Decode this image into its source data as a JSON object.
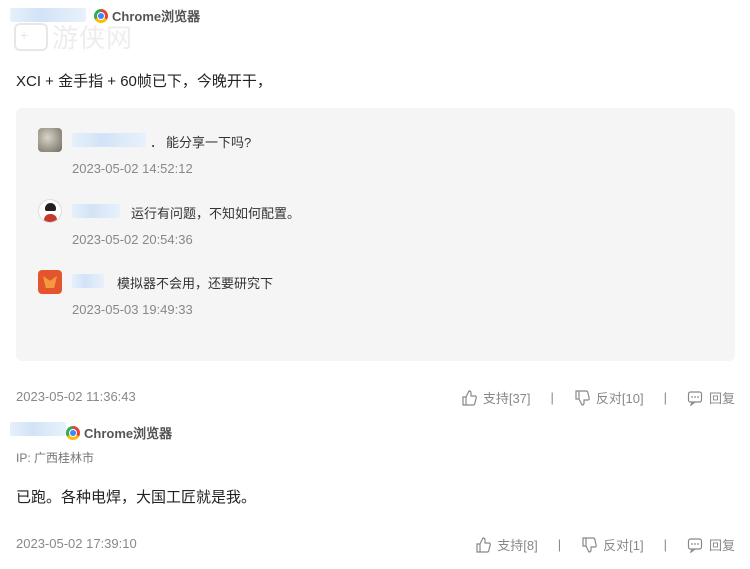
{
  "watermark": {
    "text": "游侠网"
  },
  "comment1": {
    "browser": "Chrome浏览器",
    "text": "XCI + 金手指 + 60帧已下，今晚开干，",
    "time": "2023-05-02 11:36:43",
    "support": "支持[37]",
    "oppose": "反对[10]",
    "reply": "回复",
    "replies": [
      {
        "name_suffix": "．",
        "text": "能分享一下吗?",
        "time": "2023-05-02 14:52:12"
      },
      {
        "text": "运行有问题，不知如何配置。",
        "time": "2023-05-02 20:54:36"
      },
      {
        "text": "模拟器不会用，还要研究下",
        "time": "2023-05-03 19:49:33"
      }
    ]
  },
  "comment2": {
    "browser": "Chrome浏览器",
    "ip": "IP: 广西桂林市",
    "text": "已跑。各种电焊，大国工匠就是我。",
    "time": "2023-05-02 17:39:10",
    "support": "支持[8]",
    "oppose": "反对[1]",
    "reply": "回复"
  },
  "separator": "|",
  "icons": {
    "chrome": "chrome-logo-icon",
    "like": "thumbs-up-icon",
    "dislike": "thumbs-down-icon",
    "reply": "speech-bubble-icon"
  }
}
